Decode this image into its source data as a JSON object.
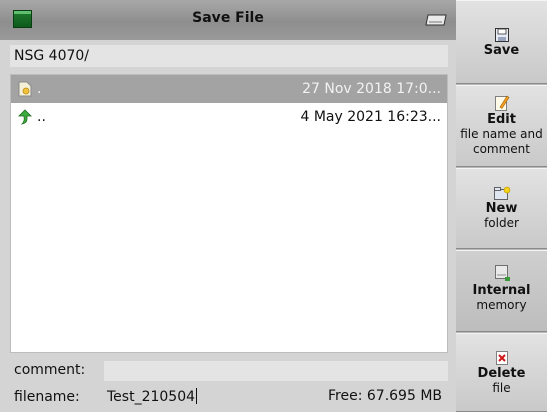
{
  "window": {
    "title": "Save File"
  },
  "path": "NSG 4070/",
  "files": [
    {
      "name": ".",
      "date": "27 Nov 2018 17:0...",
      "icon": "folder-current-icon",
      "selected": true
    },
    {
      "name": "..",
      "date": "4 May 2021 16:23...",
      "icon": "folder-up-arrow-icon",
      "selected": false
    }
  ],
  "form": {
    "comment_label": "comment:",
    "comment_value": "",
    "filename_label": "filename:",
    "filename_value": "Test_210504",
    "free_space": "Free: 67.695 MB"
  },
  "sidebar": {
    "save": {
      "bold": "Save",
      "sub": ""
    },
    "edit": {
      "bold": "Edit",
      "sub": "file name and comment"
    },
    "new_folder": {
      "bold": "New",
      "sub": "folder"
    },
    "memory": {
      "bold": "Internal",
      "sub": "memory"
    },
    "delete": {
      "bold": "Delete",
      "sub": "file"
    }
  },
  "colors": {
    "selection": "#a3a3a3",
    "sidebar_bg": "#d6d6d6",
    "app_icon": "#1e7a2e"
  }
}
